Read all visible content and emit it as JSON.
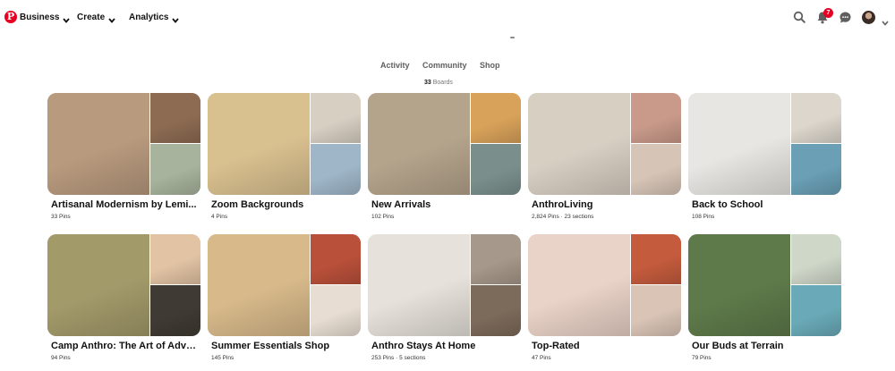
{
  "nav": {
    "logo_glyph": "P",
    "items": [
      {
        "label": "Business"
      },
      {
        "label": "Create"
      },
      {
        "label": "Analytics"
      }
    ],
    "notification_count": "7"
  },
  "tabs": [
    {
      "label": "Activity"
    },
    {
      "label": "Community"
    },
    {
      "label": "Shop"
    }
  ],
  "boards_summary": {
    "count": "33",
    "label": "Boards"
  },
  "boards": [
    {
      "title": "Artisanal Modernism by Lemi...",
      "meta": "33 Pins",
      "colors": [
        "#b89a7e",
        "#8d6b52",
        "#a7b39c"
      ]
    },
    {
      "title": "Zoom Backgrounds",
      "meta": "4 Pins",
      "colors": [
        "#d9c08f",
        "#d7cfc2",
        "#9fb6c8"
      ]
    },
    {
      "title": "New Arrivals",
      "meta": "102 Pins",
      "colors": [
        "#b5a48c",
        "#d9a25a",
        "#7a8f8c"
      ]
    },
    {
      "title": "AnthroLiving",
      "meta": "2,824 Pins · 23 sections",
      "colors": [
        "#d8cfc3",
        "#c99a8a",
        "#d6c4b6"
      ]
    },
    {
      "title": "Back to School",
      "meta": "108 Pins",
      "colors": [
        "#e8e6e2",
        "#dcd6cc",
        "#6a9fb5"
      ]
    },
    {
      "title": "Camp Anthro: The Art of Adve...",
      "meta": "94 Pins",
      "colors": [
        "#a39a6a",
        "#e2c3a4",
        "#3f3a33"
      ]
    },
    {
      "title": "Summer Essentials Shop",
      "meta": "145 Pins",
      "colors": [
        "#d7b98a",
        "#b9503a",
        "#e7ddd2"
      ]
    },
    {
      "title": "Anthro Stays At Home",
      "meta": "253 Pins · 5 sections",
      "colors": [
        "#e6e1da",
        "#a6988a",
        "#7c6a5a"
      ]
    },
    {
      "title": "Top-Rated",
      "meta": "47 Pins",
      "colors": [
        "#e9d2c7",
        "#c45b3d",
        "#d9c4b6"
      ]
    },
    {
      "title": "Our Buds at Terrain",
      "meta": "79 Pins",
      "colors": [
        "#5e7a4a",
        "#cfd7c9",
        "#6aaab8"
      ]
    }
  ]
}
